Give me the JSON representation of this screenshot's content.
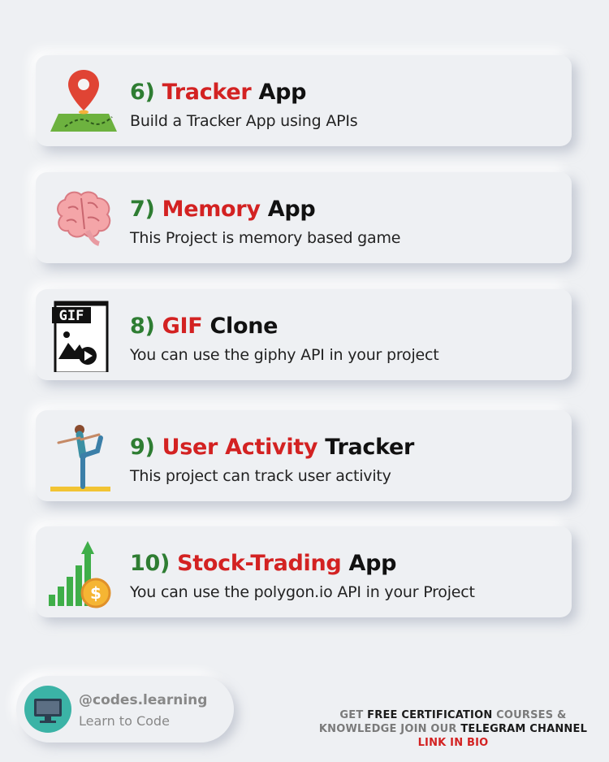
{
  "cards": [
    {
      "num": "6)",
      "highlight": "Tracker",
      "rest": " App",
      "desc": "Build a Tracker App using APIs",
      "icon": "map-pin-icon"
    },
    {
      "num": "7)",
      "highlight": "Memory",
      "rest": " App",
      "desc": "This Project is memory based game",
      "icon": "brain-icon"
    },
    {
      "num": "8)",
      "highlight": "GIF",
      "rest": " Clone",
      "desc": "You can use the giphy API in your project",
      "icon": "gif-file-icon",
      "icon_text": "GIF"
    },
    {
      "num": "9)",
      "highlight": "User Activity",
      "rest": " Tracker",
      "desc": "This project can track user activity",
      "icon": "yoga-person-icon"
    },
    {
      "num": "10)",
      "highlight": "Stock-Trading",
      "rest": " App",
      "desc": "You can use the polygon.io API in your Project",
      "icon": "stock-chart-icon",
      "icon_text": "$"
    }
  ],
  "profile": {
    "handle": "@codes.learning",
    "tagline": "Learn to Code"
  },
  "cta": {
    "p1": "GET ",
    "p2": "FREE CERTIFICATION",
    "p3": " COURSES &",
    "p4": "KNOWLEDGE JOIN OUR ",
    "p5": "TELEGRAM CHANNEL",
    "p6": "LINK IN BIO"
  },
  "colors": {
    "number": "#2e7d32",
    "highlight": "#d32222",
    "background": "#eef0f3"
  }
}
